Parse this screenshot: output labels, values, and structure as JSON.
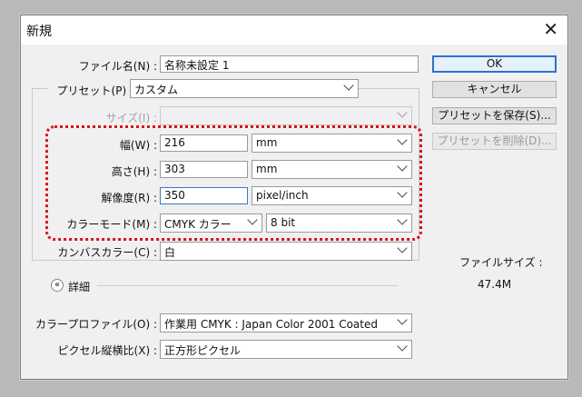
{
  "window": {
    "title": "新規",
    "close_glyph": "✕"
  },
  "form": {
    "name_label": "ファイル名(N) :",
    "name_value": "名称未設定 1",
    "preset_label": "プリセット(P) :",
    "preset_value": "カスタム",
    "size_label": "サイズ(I) :",
    "width_label": "幅(W) :",
    "width_value": "216",
    "width_unit": "mm",
    "height_label": "高さ(H) :",
    "height_value": "303",
    "height_unit": "mm",
    "resolution_label": "解像度(R) :",
    "resolution_value": "350",
    "resolution_unit": "pixel/inch",
    "colormode_label": "カラーモード(M) :",
    "colormode_value": "CMYK カラー",
    "bitdepth_value": "8 bit",
    "canvas_label": "カンバスカラー(C) :",
    "canvas_value": "白",
    "details_label": "詳細",
    "details_glyph": "«",
    "profile_label": "カラープロファイル(O) :",
    "profile_value": "作業用 CMYK : Japan Color 2001 Coated",
    "aspect_label": "ピクセル縦横比(X) :",
    "aspect_value": "正方形ピクセル"
  },
  "buttons": {
    "ok": "OK",
    "cancel": "キャンセル",
    "save_preset": "プリセットを保存(S)...",
    "delete_preset": "プリセットを削除(D)..."
  },
  "info": {
    "filesize_label": "ファイルサイズ :",
    "filesize_value": "47.4M"
  }
}
